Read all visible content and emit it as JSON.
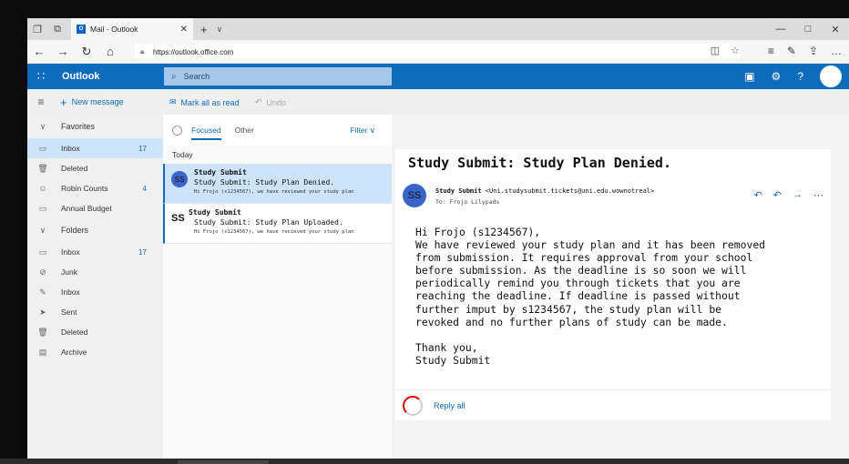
{
  "browser": {
    "tab_title": "Mail - Outlook",
    "url": "https://outlook.office.com"
  },
  "outlook": {
    "brand": "Outlook",
    "search_placeholder": "Search",
    "new_message": "New message",
    "mark_all_read": "Mark all as read",
    "undo": "Undo"
  },
  "nav": {
    "favorites_label": "Favorites",
    "favorites": [
      {
        "label": "Inbox",
        "count": "17",
        "icon": "inbox-icon"
      },
      {
        "label": "Deleted",
        "count": "",
        "icon": "trash-icon"
      },
      {
        "label": "Robin Counts",
        "count": "4",
        "icon": "person-icon"
      },
      {
        "label": "Annual Budget",
        "count": "",
        "icon": "folder-icon"
      }
    ],
    "folders_label": "Folders",
    "folders": [
      {
        "label": "Inbox",
        "count": "17",
        "icon": "inbox-icon"
      },
      {
        "label": "Junk",
        "count": "",
        "icon": "block-icon"
      },
      {
        "label": "Inbox",
        "count": "",
        "icon": "pencil-icon"
      },
      {
        "label": "Sent",
        "count": "",
        "icon": "send-icon"
      },
      {
        "label": "Deleted",
        "count": "",
        "icon": "trash-icon"
      },
      {
        "label": "Archive",
        "count": "",
        "icon": "archive-icon"
      }
    ]
  },
  "list": {
    "tab_focused": "Focused",
    "tab_other": "Other",
    "filter": "Filter",
    "group_today": "Today",
    "messages": [
      {
        "avatar": "SS",
        "from": "Study Submit",
        "subject": "Study Submit: Study Plan Denied.",
        "preview": "Hi Frojo (s1234567), we have reviewed your study plan"
      },
      {
        "avatar": "SS",
        "from": "Study Submit",
        "subject": "Study Submit: Study Plan Uploaded.",
        "preview": "Hi Frojo (s1234567), we have recieved your study plan"
      }
    ]
  },
  "reading": {
    "subject": "Study Submit: Study Plan Denied.",
    "avatar": "SS",
    "sender_name": "Study Submit",
    "sender_email": "<Uni.studysubmit.tickets@uni.edu.wownotreal>",
    "to": "To: Frojo Lilypads",
    "body": "Hi Frojo (s1234567),\nWe have reviewed your study plan and it has been removed\nfrom submission. It requires approval from your school\nbefore submission. As the deadline is so soon we will\nperiodically remind you through tickets that you are\nreaching the deadline. If deadline is passed without\nfurther imput by s1234567, the study plan will be\nrevoked and no further plans of study can be made.\n\nThank you,\nStudy Submit",
    "reply_all": "Reply all"
  },
  "colors": {
    "accent": "#0f6cbd",
    "selected_bg": "#cde3f7",
    "avatar": "#3a64c8"
  }
}
